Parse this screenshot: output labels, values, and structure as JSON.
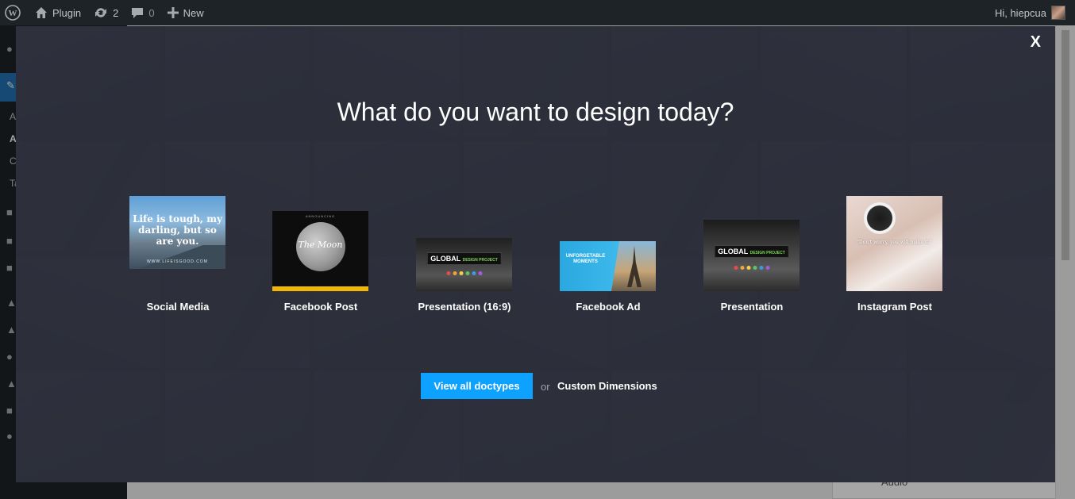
{
  "admin_bar": {
    "site_name": "Plugin",
    "updates_count": "2",
    "comments_count": "0",
    "new_label": "New",
    "greeting": "Hi, hiepcua"
  },
  "wp_sidebar": {
    "visible_submenu_letters": [
      "A",
      "A",
      "C",
      "Ta"
    ]
  },
  "wp_content": {
    "audio_label": "Audio"
  },
  "modal": {
    "close_label": "X",
    "title": "What do you want to design today?",
    "doc_types": [
      {
        "label": "Social Media",
        "thumb_text": "Life is tough, my darling, but so are you.",
        "thumb_footer": "WWW.LIFEISGOOD.COM"
      },
      {
        "label": "Facebook Post",
        "thumb_text": "The Moon",
        "thumb_footer": "ANNOUNCING"
      },
      {
        "label": "Presentation (16:9)",
        "thumb_text": "GLOBAL",
        "thumb_sub": "DESIGN PROJECT"
      },
      {
        "label": "Facebook Ad",
        "thumb_text": "UNFORGETABLE MOMENTS"
      },
      {
        "label": "Presentation",
        "thumb_text": "GLOBAL",
        "thumb_sub": "DESIGN PROJECT"
      },
      {
        "label": "Instagram Post",
        "thumb_text": "\"Don't worry, you will make it.\""
      }
    ],
    "view_all_label": "View all doctypes",
    "or_label": "or",
    "custom_dimensions_label": "Custom Dimensions"
  },
  "colors": {
    "admin_bar_bg": "#1d2327",
    "modal_bg": "#2e313c",
    "primary_button": "#0da2ff",
    "wp_active_blue": "#2271b1"
  }
}
